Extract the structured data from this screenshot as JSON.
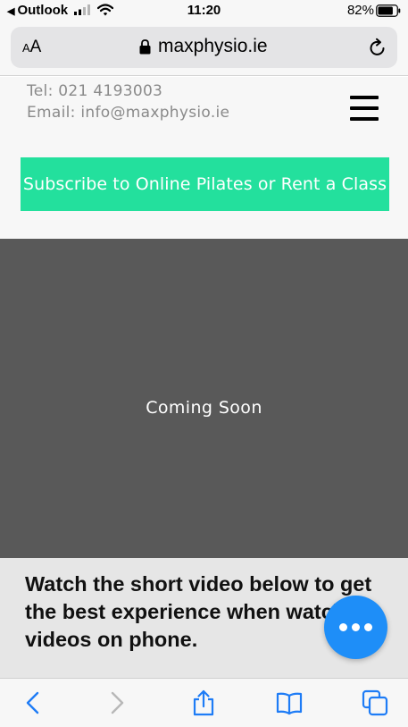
{
  "status_bar": {
    "back_app": "Outlook",
    "time": "11:20",
    "battery_percent": "82%",
    "battery_level": 0.82
  },
  "browser": {
    "text_size_small": "A",
    "text_size_large": "A",
    "domain": "maxphysio.ie"
  },
  "header": {
    "phone": "Tel: 021 4193003",
    "email": "Email: info@maxphysio.ie"
  },
  "subscribe": {
    "label": "Subscribe to Online Pilates or Rent a Class",
    "color": "#23e09d"
  },
  "video": {
    "placeholder": "Coming Soon",
    "background": "#595959"
  },
  "notice": {
    "text": "Watch the short video below to get the best experience when watching videos on phone."
  },
  "fab": {
    "icon": "more-dots-icon",
    "color": "#1e8ef8"
  },
  "toolbar": {
    "icons": [
      "back-icon",
      "forward-icon",
      "share-icon",
      "bookmarks-icon",
      "tabs-icon"
    ],
    "accent": "#1e7cf6"
  }
}
